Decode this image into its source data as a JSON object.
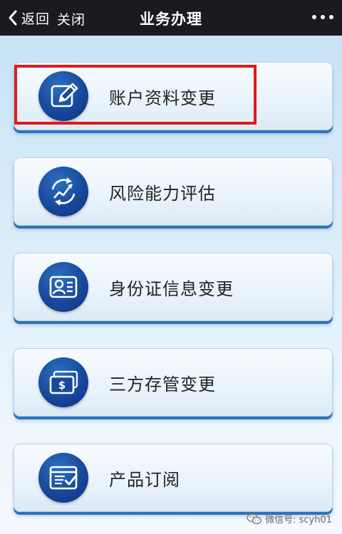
{
  "header": {
    "back_label": "返回",
    "close_label": "关闭",
    "title": "业务办理"
  },
  "menu": [
    {
      "label": "账户资料变更",
      "icon": "edit-icon"
    },
    {
      "label": "风险能力评估",
      "icon": "trend-chart-icon"
    },
    {
      "label": "身份证信息变更",
      "icon": "id-card-icon"
    },
    {
      "label": "三方存管变更",
      "icon": "money-card-icon"
    },
    {
      "label": "产品订阅",
      "icon": "subscription-icon"
    }
  ],
  "highlight": {
    "target": "账户资料变更",
    "color": "#e01a1a"
  },
  "watermark": {
    "text": "微信号: scyh01"
  },
  "colors": {
    "header_bg": "#1b1b1f",
    "icon_blue": "#18489c",
    "button_shadow": "#2d73ba"
  }
}
